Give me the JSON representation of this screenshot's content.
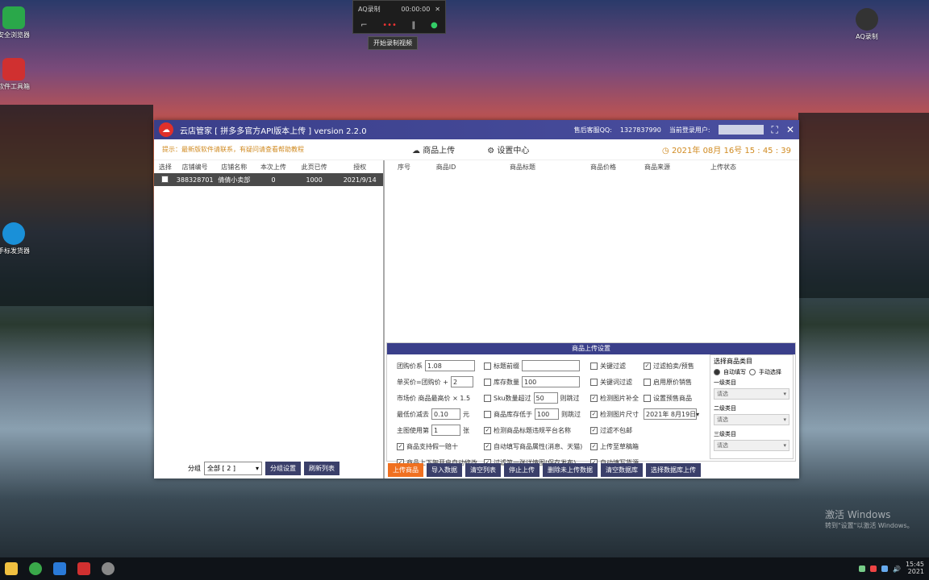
{
  "desktop": {
    "icons": [
      {
        "label": "安全浏览器",
        "color": "#2aa84a"
      },
      {
        "label": "软件工具箱",
        "color": "#d03030"
      },
      {
        "label": "手标发货器",
        "color": "#1a90d8"
      },
      {
        "label": "AQ录制",
        "color": "#333333"
      }
    ]
  },
  "recorder": {
    "title": "AQ录制",
    "time": "00:00:00",
    "close": "✕",
    "tooltip": "开始录制视频"
  },
  "app": {
    "title": "云店管家 [ 拼多多官方API版本上传 ] version 2.2.0",
    "qq_label": "售后客服QQ:",
    "qq": "1327837990",
    "user_label": "当前登录用户:",
    "notice": "提示：最新版软件请联系，有疑问请查看帮助教程",
    "nav_upload": "商品上传",
    "nav_settings": "设置中心",
    "clock": "2021年 08月 16号 15 : 45 : 39",
    "minimize": "⛶",
    "close": "✕"
  },
  "shops": {
    "headers": [
      "选择",
      "店铺编号",
      "店铺名称",
      "本次上传",
      "此页已传",
      "授权"
    ],
    "rows": [
      {
        "id": "388328701",
        "name": "倩倩小卖部",
        "count": "0",
        "limit": "1000",
        "date": "2021/9/14"
      }
    ],
    "group_label": "分组",
    "group_value": "全部 [ 2 ]",
    "btn_group": "分组设置",
    "btn_refresh": "刷新列表"
  },
  "products": {
    "headers": [
      "序号",
      "商品ID",
      "商品标题",
      "商品价格",
      "商品来源",
      "上传状态"
    ]
  },
  "settings": {
    "title": "商品上传设置",
    "col1": {
      "group_price_label": "团购价系",
      "group_price": "1.08",
      "single_label": "单买价=团购价 +",
      "single": "2",
      "market_label": "市场价  商品最高价 × 1.5",
      "price_cut_label": "最低价减去",
      "price_cut": "0.10",
      "price_unit": "元",
      "main_img_label": "主图使用第",
      "main_img": "1",
      "main_img_unit": "张",
      "opt1": "商品支持假一赔十",
      "opt2": "商品上下架开启自动修改"
    },
    "col2": {
      "opt_title": "标题前缀",
      "opt_stock": "库存数量",
      "stock": "100",
      "opt_sku": "Sku数量超过",
      "sku": "50",
      "sku_tail": "则跳过",
      "opt_low": "商品库存低于",
      "low": "100",
      "low_tail": "则跳过",
      "opt_check": "检测商品标题违规平台名称",
      "opt_auto": "自动填写商品属性(消息、天猫)",
      "opt_filter": "过滤第一张详情图(保存发布)"
    },
    "col3": {
      "opt_kw": "关键过滤",
      "opt_kw2": "关键词过滤",
      "opt_img": "检测图片补全",
      "opt_img2": "检测图片尺寸",
      "opt_filter": "过滤不包邮",
      "opt_upload": "上传至草稿箱",
      "opt_auto": "自动填写货源"
    },
    "col4": {
      "opt_filter": "过滤拍卖/预售",
      "opt_enable": "启用原价销售",
      "opt_date": "设置预售商品",
      "date": "2021年 8月19日"
    },
    "category": {
      "title": "选择商品类目",
      "radio1": "自动填写",
      "radio2": "手动选择",
      "level1_label": "一级类目",
      "level1": "请选",
      "level2_label": "二级类目",
      "level2": "请选",
      "level3_label": "三级类目",
      "level3": "请选"
    },
    "buttons": [
      "上传商品",
      "导入数据",
      "清空列表",
      "停止上传",
      "删除未上传数据",
      "清空数据库",
      "选择数据库上传"
    ]
  },
  "watermark": {
    "line1": "激活 Windows",
    "line2": "转到\"设置\"以激活 Windows。"
  },
  "taskbar": {
    "time": "15:45",
    "date": "2021"
  }
}
